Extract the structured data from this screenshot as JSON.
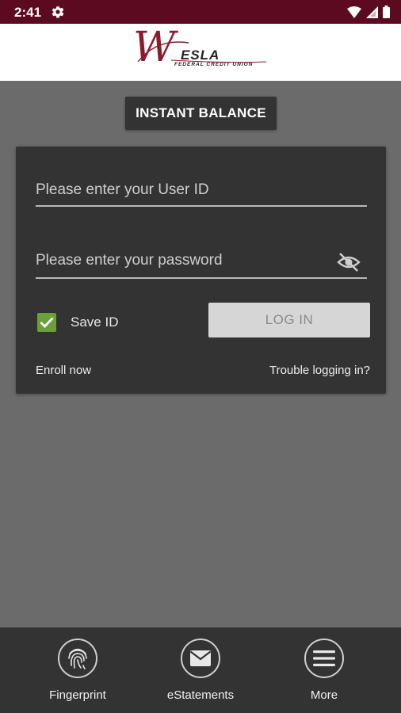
{
  "status_bar": {
    "time": "2:41"
  },
  "header": {
    "logo_script": "W",
    "logo_name": "ESLA",
    "logo_subtitle": "FEDERAL CREDIT UNION"
  },
  "instant_balance": {
    "label": "INSTANT BALANCE"
  },
  "login": {
    "userid_placeholder": "Please enter your User ID",
    "password_placeholder": "Please enter your password",
    "save_id_label": "Save ID",
    "save_id_checked": true,
    "login_label": "LOG IN",
    "enroll_label": "Enroll now",
    "trouble_label": "Trouble logging in?"
  },
  "bottom_nav": {
    "items": [
      {
        "label": "Fingerprint",
        "icon": "fingerprint-icon"
      },
      {
        "label": "eStatements",
        "icon": "envelope-icon"
      },
      {
        "label": "More",
        "icon": "menu-icon"
      }
    ]
  },
  "colors": {
    "status_bar": "#5c0a1f",
    "brand_red": "#8b1c2e",
    "card": "#333333",
    "background": "#6b6b6b",
    "checkbox": "#6a9f3a"
  }
}
